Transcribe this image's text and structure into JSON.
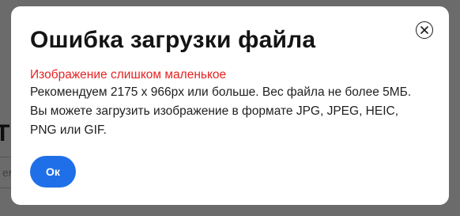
{
  "background": {
    "heading_fragment": "T",
    "input_fragment": "ем"
  },
  "modal": {
    "title": "Ошибка загрузки файла",
    "error_message": "Изображение слишком маленькое",
    "description_lines": [
      "Рекомендуем 2175 x 966px или больше. Вес файла не более 5МБ.",
      "Вы можете загрузить изображение в формате JPG, JPEG, HEIC,",
      "PNG или GIF."
    ],
    "ok_label": "Ок",
    "close_icon": "close-circle-x"
  },
  "colors": {
    "overlay": "#000000",
    "error": "#e62222",
    "primary_button": "#1f6fe8"
  }
}
